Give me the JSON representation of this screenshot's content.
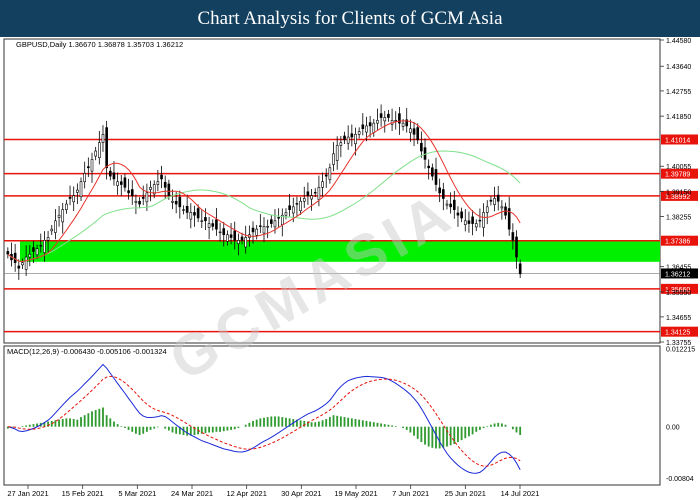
{
  "banner": {
    "title": "Chart Analysis for Clients of GCM Asia"
  },
  "watermark": "GCMASIA",
  "chart_data": {
    "type": "candlestick",
    "symbol_info": "GBPUSD,Daily  1.36670 1.36878 1.35703 1.36212",
    "price_axis": {
      "ylim": [
        1.33755,
        1.4458
      ],
      "ticks": [
        "1.44580",
        "1.43640",
        "1.42755",
        "1.41850",
        "1.40055",
        "1.39150",
        "1.38255",
        "1.36455",
        "1.35550",
        "1.34655",
        "1.33755"
      ]
    },
    "horizontal_levels": [
      {
        "label": "1.41014",
        "value": 1.41014,
        "color": "#e8130a"
      },
      {
        "label": "1.39789",
        "value": 1.39789,
        "color": "#e8130a"
      },
      {
        "label": "1.38992",
        "value": 1.38992,
        "color": "#e8130a"
      },
      {
        "label": "1.37386",
        "value": 1.37386,
        "color": "#e8130a"
      },
      {
        "label": "1.35660",
        "value": 1.3566,
        "color": "#e8130a"
      },
      {
        "label": "1.34125",
        "value": 1.34125,
        "color": "#e8130a"
      }
    ],
    "current_price": {
      "label": "1.36212",
      "value": 1.36212
    },
    "support_zone": {
      "from": 1.3663,
      "to": 1.3738,
      "color": "#00f000"
    },
    "date_ticks": [
      "27 Jan 2021",
      "15 Feb 2021",
      "5 Mar 2021",
      "24 Mar 2021",
      "12 Apr 2021",
      "30 Apr 2021",
      "19 May 2021",
      "7 Jun 2021",
      "25 Jun 2021",
      "14 Jul 2021"
    ],
    "closes": [
      1.369,
      1.367,
      1.366,
      1.364,
      1.366,
      1.368,
      1.369,
      1.37,
      1.371,
      1.372,
      1.374,
      1.375,
      1.378,
      1.381,
      1.383,
      1.385,
      1.387,
      1.389,
      1.39,
      1.392,
      1.395,
      1.398,
      1.4,
      1.403,
      1.406,
      1.409,
      1.412,
      1.4,
      1.397,
      1.396,
      1.395,
      1.394,
      1.393,
      1.391,
      1.39,
      1.388,
      1.387,
      1.389,
      1.391,
      1.393,
      1.394,
      1.395,
      1.396,
      1.393,
      1.39,
      1.388,
      1.387,
      1.386,
      1.385,
      1.384,
      1.384,
      1.383,
      1.382,
      1.381,
      1.381,
      1.38,
      1.379,
      1.378,
      1.377,
      1.376,
      1.376,
      1.375,
      1.374,
      1.374,
      1.374,
      1.375,
      1.376,
      1.377,
      1.378,
      1.379,
      1.379,
      1.379,
      1.38,
      1.381,
      1.382,
      1.383,
      1.384,
      1.385,
      1.386,
      1.387,
      1.388,
      1.389,
      1.39,
      1.39,
      1.391,
      1.393,
      1.395,
      1.397,
      1.4,
      1.405,
      1.408,
      1.409,
      1.41,
      1.411,
      1.411,
      1.412,
      1.413,
      1.414,
      1.415,
      1.415,
      1.416,
      1.417,
      1.418,
      1.418,
      1.418,
      1.417,
      1.417,
      1.416,
      1.416,
      1.415,
      1.414,
      1.412,
      1.41,
      1.406,
      1.403,
      1.4,
      1.397,
      1.394,
      1.391,
      1.389,
      1.387,
      1.386,
      1.385,
      1.383,
      1.382,
      1.381,
      1.38,
      1.38,
      1.38,
      1.381,
      1.384,
      1.386,
      1.388,
      1.389,
      1.388,
      1.386,
      1.383,
      1.378,
      1.374,
      1.368,
      1.362
    ],
    "ma_fast_name": "MA red",
    "ma_slow_name": "MA green",
    "macd": {
      "label": "MACD(12,26,9) -0.006430 -0.005106 -0.001324",
      "ylim": [
        -0.0088,
        0.0123
      ],
      "ticks": [
        "0.012215",
        "0.00",
        "-0.00804"
      ],
      "hist": [
        -0.0003,
        -0.0002,
        -0.0001,
        0.0,
        0.0001,
        0.0002,
        0.0003,
        0.0004,
        0.0005,
        0.0006,
        0.0007,
        0.0008,
        0.0009,
        0.001,
        0.0011,
        0.0012,
        0.0013,
        0.0013,
        0.0012,
        0.0011,
        0.0015,
        0.0018,
        0.0021,
        0.0024,
        0.0026,
        0.0028,
        0.003,
        0.0018,
        0.0013,
        0.0008,
        0.0004,
        0.0001,
        -0.0002,
        -0.0005,
        -0.0008,
        -0.0011,
        -0.0013,
        -0.0011,
        -0.0008,
        -0.0005,
        -0.0003,
        -0.0001,
        0.0,
        -0.0003,
        -0.0006,
        -0.0009,
        -0.0011,
        -0.0012,
        -0.0013,
        -0.0014,
        -0.0014,
        -0.0013,
        -0.0012,
        -0.0011,
        -0.001,
        -0.0009,
        -0.0009,
        -0.0008,
        -0.0008,
        -0.0007,
        -0.0006,
        -0.0005,
        -0.0004,
        -0.0002,
        0.0,
        0.0003,
        0.0006,
        0.0009,
        0.0011,
        0.0013,
        0.0014,
        0.0015,
        0.0016,
        0.0016,
        0.0016,
        0.0015,
        0.0014,
        0.0013,
        0.0012,
        0.0011,
        0.001,
        0.0009,
        0.0008,
        0.0007,
        0.0007,
        0.0008,
        0.001,
        0.0012,
        0.0015,
        0.0018,
        0.0017,
        0.0016,
        0.0015,
        0.0014,
        0.0013,
        0.0012,
        0.0011,
        0.001,
        0.0009,
        0.0008,
        0.0007,
        0.0006,
        0.0005,
        0.0004,
        0.0003,
        0.0002,
        0.0001,
        0.0,
        -0.0002,
        -0.0005,
        -0.0009,
        -0.0014,
        -0.0019,
        -0.0024,
        -0.0028,
        -0.0031,
        -0.0033,
        -0.0034,
        -0.0034,
        -0.0033,
        -0.0031,
        -0.0029,
        -0.0027,
        -0.0024,
        -0.0021,
        -0.0018,
        -0.0015,
        -0.0012,
        -0.0008,
        -0.0005,
        -0.0002,
        0.0001,
        0.0003,
        0.0005,
        0.0006,
        0.0005,
        0.0003,
        0.0,
        -0.0004,
        -0.0009,
        -0.0013
      ]
    }
  }
}
